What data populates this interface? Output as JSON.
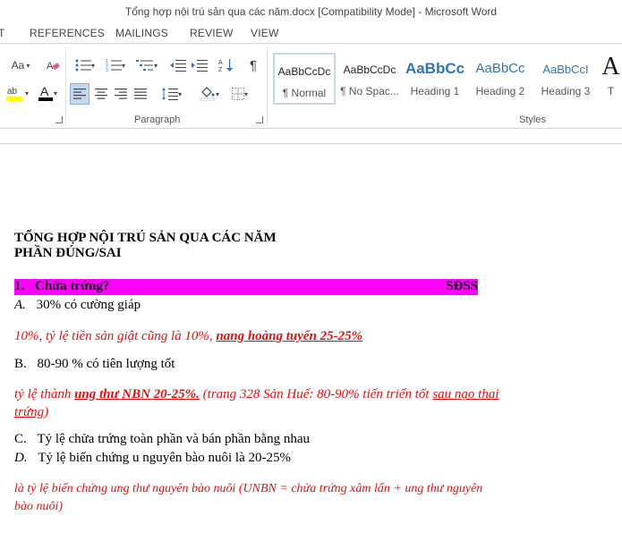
{
  "window": {
    "title": "Tổng hợp nội trú sản qua các năm.docx [Compatibility Mode] - Microsoft Word"
  },
  "tabs": {
    "t0": "T",
    "references": "REFERENCES",
    "mailings": "MAILINGS",
    "review": "REVIEW",
    "view": "VIEW"
  },
  "ribbon": {
    "font_size_label": "Aa",
    "paragraph_label": "Paragraph",
    "styles_label": "Styles",
    "styles": [
      {
        "sample": "AaBbCcDc",
        "name": "¶ Normal"
      },
      {
        "sample": "AaBbCcDc",
        "name": "¶ No Spac..."
      },
      {
        "sample": "AaBbCc",
        "name": "Heading 1"
      },
      {
        "sample": "AaBbCc",
        "name": "Heading 2"
      },
      {
        "sample": "AaBbCcI",
        "name": "Heading 3"
      },
      {
        "sample": "A",
        "name": "T"
      }
    ],
    "colors": {
      "highlight": "#ffff00",
      "font_color": "#000000",
      "style_heading": "#2e74b5"
    }
  },
  "document": {
    "title_line1": "TỔNG HỢP NỘI TRÚ SẢN QUA CÁC NĂM",
    "title_line2": "PHẦN ĐÚNG/SAI",
    "q1_number": "1.",
    "q1_text": "Chửa trứng?",
    "q1_tag": "SĐSS",
    "a_letter": "A.",
    "a_text": "30% có cường giáp",
    "a_note_prefix": "10%, tỷ lệ tiền sản giật cũng là 10%, ",
    "a_note_emph": "nang hoàng tuyến 25-25%",
    "b_letter": "B.",
    "b_text": "80-90 % có tiên lượng tốt",
    "b_note_prefix": "tỷ lệ thành ",
    "b_note_emph": "ung thư NBN 20-25%.",
    "b_note_mid": " (trang 328 Sản Huế: 80-90% tiến triển tốt ",
    "b_note_underline": "sau nạo thai",
    "b_note_line2_underline": "trứng",
    "b_note_line2_end": ")",
    "c_letter": "C.",
    "c_text": "Tỷ lệ chửa trứng toàn phần và bán phần bằng nhau",
    "d_letter": "D.",
    "d_text": "Tỷ lệ biến chứng u nguyên bào nuôi là 20-25%",
    "d_note_line1": "là tỷ lệ biến chứng ung thư nguyên bào nuôi (UNBN = chửa trứng xâm lấn + ung thư nguyên",
    "d_note_line2": "bào nuôi)",
    "colors": {
      "highlight": "#ff00ff",
      "note_red": "#e01010"
    }
  }
}
